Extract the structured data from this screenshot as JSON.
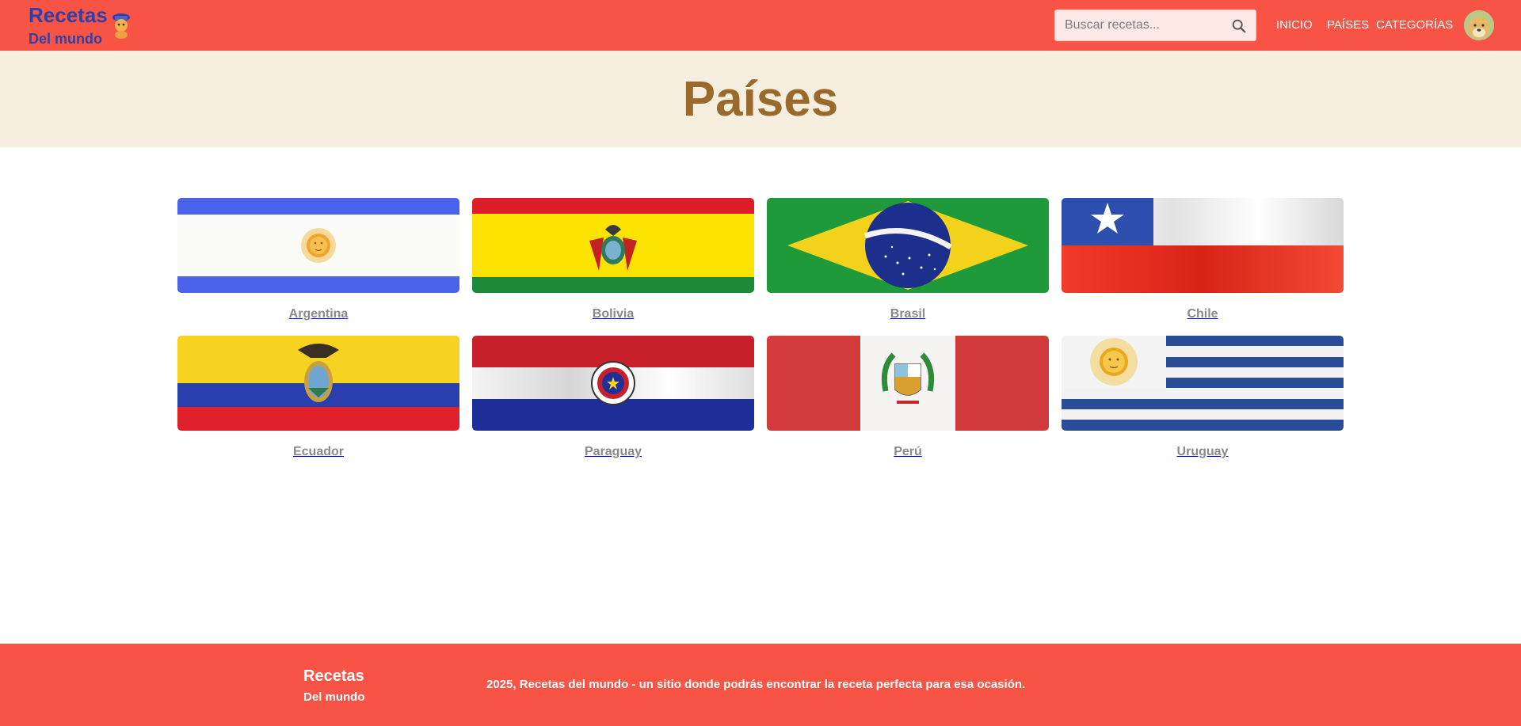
{
  "header": {
    "logo_title": "Recetas",
    "logo_subtitle": "Del mundo",
    "search_placeholder": "Buscar recetas...",
    "nav": {
      "inicio": "INICIO",
      "paises": "PAÍSES",
      "categorias": "CATEGORÍAS"
    }
  },
  "hero": {
    "title": "Países"
  },
  "countries": [
    {
      "name": "Argentina",
      "flag_icon": "argentina-flag"
    },
    {
      "name": "Bolivia",
      "flag_icon": "bolivia-flag"
    },
    {
      "name": "Brasil",
      "flag_icon": "brasil-flag"
    },
    {
      "name": "Chile",
      "flag_icon": "chile-flag"
    },
    {
      "name": "Ecuador",
      "flag_icon": "ecuador-flag"
    },
    {
      "name": "Paraguay",
      "flag_icon": "paraguay-flag"
    },
    {
      "name": "Perú",
      "flag_icon": "peru-flag"
    },
    {
      "name": "Uruguay",
      "flag_icon": "uruguay-flag"
    }
  ],
  "footer": {
    "logo_title": "Recetas",
    "logo_subtitle": "Del mundo",
    "text": "2025, Recetas del mundo - un sitio donde podrás encontrar la receta perfecta para esa ocasión."
  },
  "colors": {
    "brand": "#f85446",
    "logo": "#2e3fa8",
    "hero_bg": "#f6efe0",
    "hero_title": "#9a6a2c",
    "label": "#8a8a8a"
  }
}
